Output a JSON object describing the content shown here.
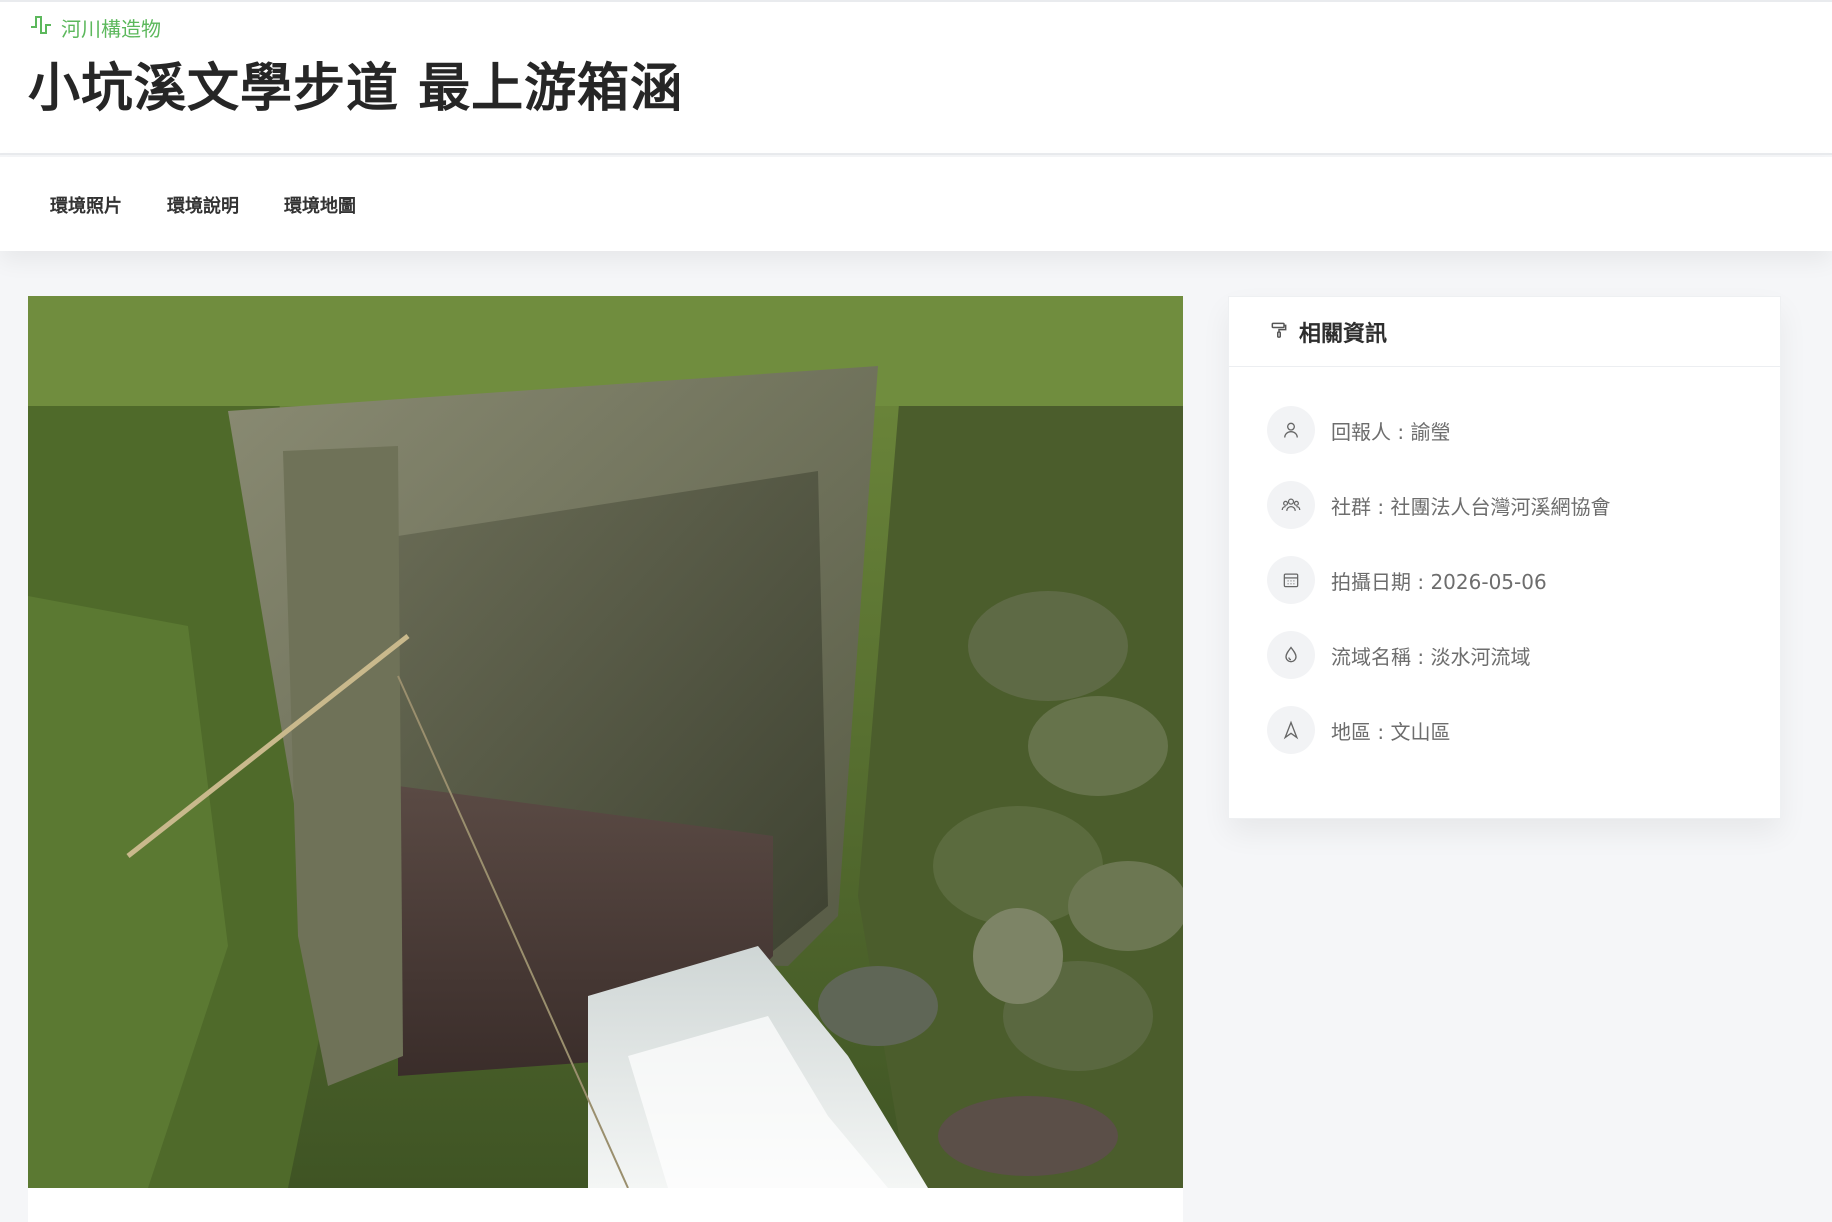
{
  "header": {
    "category": "河川構造物",
    "title": "小坑溪文學步道 最上游箱涵",
    "category_color": "#5cb85c"
  },
  "tabs": [
    {
      "label": "環境照片"
    },
    {
      "label": "環境說明"
    },
    {
      "label": "環境地圖"
    }
  ],
  "info": {
    "title": "相關資訊",
    "items": [
      {
        "icon": "user-icon",
        "label": "回報人",
        "value": "諭瑩"
      },
      {
        "icon": "group-icon",
        "label": "社群",
        "value": "社團法人台灣河溪網協會"
      },
      {
        "icon": "calendar-icon",
        "label": "拍攝日期",
        "value": "2026-05-06"
      },
      {
        "icon": "water-drop-icon",
        "label": "流域名稱",
        "value": "淡水河流域"
      },
      {
        "icon": "navigation-icon",
        "label": "地區",
        "value": "文山區"
      }
    ],
    "separator": " : "
  }
}
